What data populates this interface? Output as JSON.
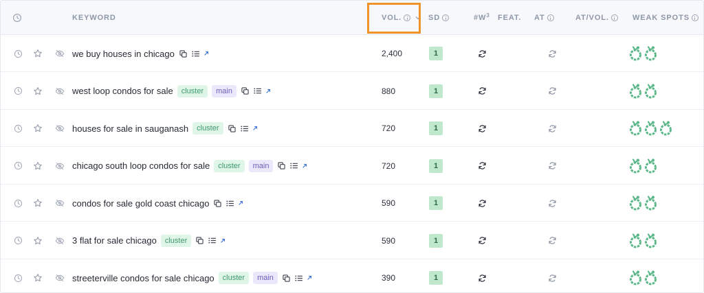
{
  "header": {
    "keyword": "KEYWORD",
    "vol": "VOL.",
    "sd": "SD",
    "w": "#W",
    "w_sup": "3",
    "feat": "FEAT.",
    "at": "AT",
    "at_vol": "AT/VOL.",
    "weak_spots": "WEAK SPOTS"
  },
  "tags": {
    "cluster": "cluster",
    "main": "main"
  },
  "rows": [
    {
      "keyword": "we buy houses in chicago",
      "cluster": false,
      "main": false,
      "volume": "2,400",
      "sd": "1",
      "weak_spots": 2
    },
    {
      "keyword": "west loop condos for sale",
      "cluster": true,
      "main": true,
      "volume": "880",
      "sd": "1",
      "weak_spots": 2
    },
    {
      "keyword": "houses for sale in sauganash",
      "cluster": true,
      "main": false,
      "volume": "720",
      "sd": "1",
      "weak_spots": 3
    },
    {
      "keyword": "chicago south loop condos for sale",
      "cluster": true,
      "main": true,
      "volume": "720",
      "sd": "1",
      "weak_spots": 2
    },
    {
      "keyword": "condos for sale gold coast chicago",
      "cluster": false,
      "main": false,
      "volume": "590",
      "sd": "1",
      "weak_spots": 2
    },
    {
      "keyword": "3 flat for sale chicago",
      "cluster": true,
      "main": false,
      "volume": "590",
      "sd": "1",
      "weak_spots": 2
    },
    {
      "keyword": "streeterville condos for sale chicago",
      "cluster": true,
      "main": true,
      "volume": "390",
      "sd": "1",
      "weak_spots": 2
    }
  ],
  "colors": {
    "accent_highlight": "#f0932b",
    "sd_badge": "#bfe8cc",
    "weak_spot": "#5cb889",
    "cluster_bg": "#dff5e8",
    "main_bg": "#ece8fb"
  },
  "icons": {
    "history": "clock-icon",
    "favorite": "star-icon",
    "hide": "eye-slash-icon",
    "copy": "copy-icon",
    "list": "list-icon",
    "open": "external-link-icon",
    "refresh": "refresh-icon",
    "weak_spot": "reddit-logo-icon",
    "sort": "chevron-down-icon"
  }
}
